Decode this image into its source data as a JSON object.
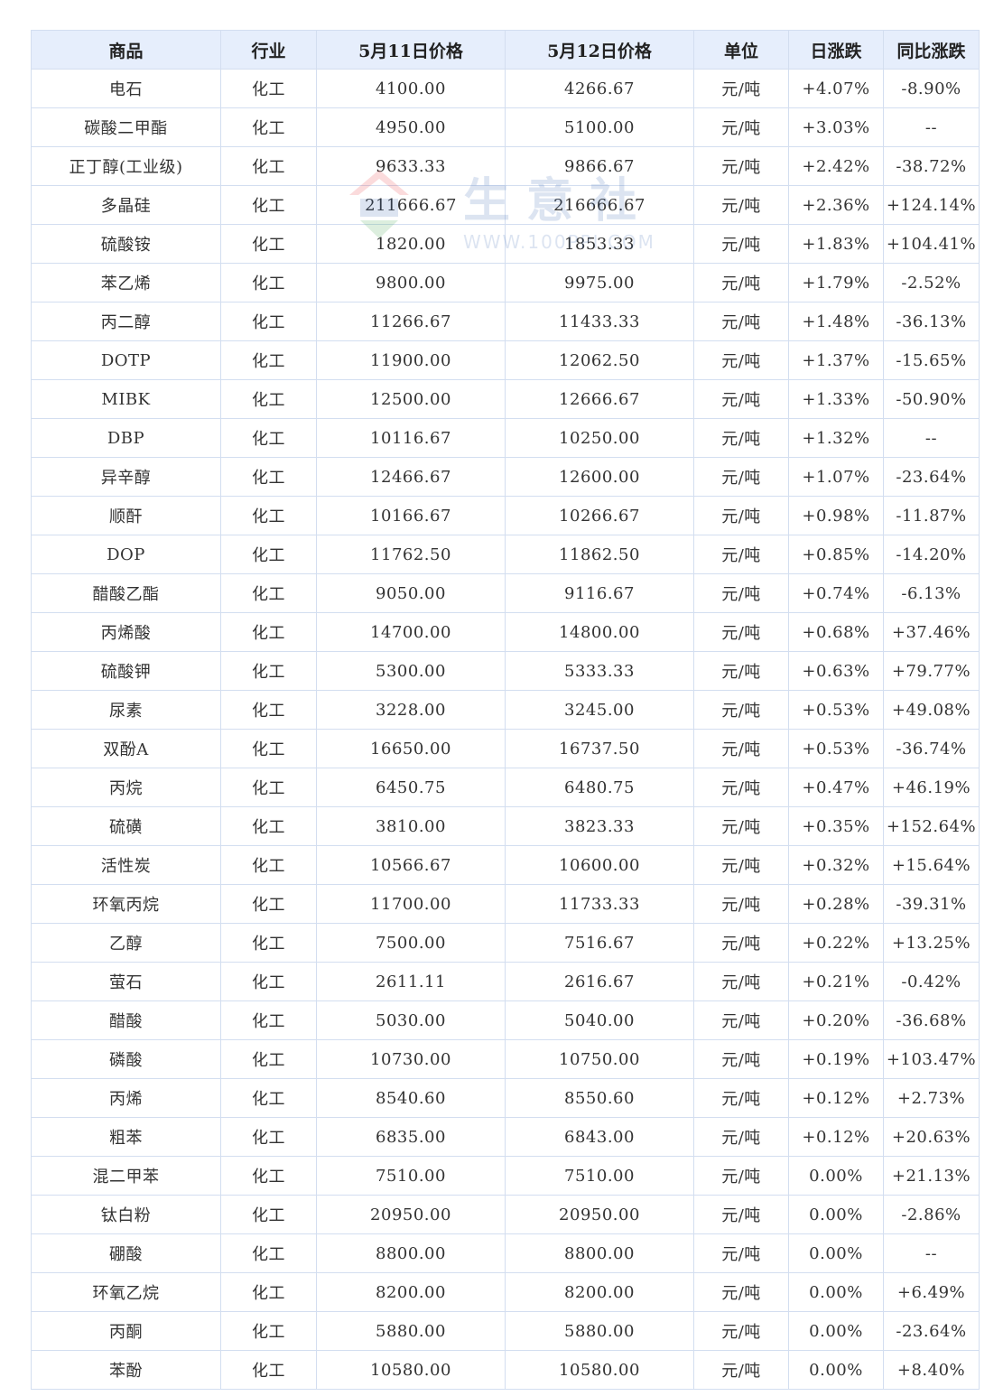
{
  "table": {
    "headers": {
      "name": "商品",
      "industry": "行业",
      "price_prev": "5月11日价格",
      "price_curr": "5月12日价格",
      "unit": "单位",
      "daily_change": "日涨跌",
      "yoy_change": "同比涨跌"
    },
    "rows": [
      {
        "name": "电石",
        "industry": "化工",
        "price_prev": "4100.00",
        "price_curr": "4266.67",
        "unit": "元/吨",
        "daily_change": "+4.07%",
        "daily_dir": "up",
        "yoy_change": "-8.90%",
        "yoy_dir": "down"
      },
      {
        "name": "碳酸二甲酯",
        "industry": "化工",
        "price_prev": "4950.00",
        "price_curr": "5100.00",
        "unit": "元/吨",
        "daily_change": "+3.03%",
        "daily_dir": "up",
        "yoy_change": "--",
        "yoy_dir": "flat"
      },
      {
        "name": "正丁醇(工业级)",
        "industry": "化工",
        "price_prev": "9633.33",
        "price_curr": "9866.67",
        "unit": "元/吨",
        "daily_change": "+2.42%",
        "daily_dir": "up",
        "yoy_change": "-38.72%",
        "yoy_dir": "down"
      },
      {
        "name": "多晶硅",
        "industry": "化工",
        "price_prev": "211666.67",
        "price_curr": "216666.67",
        "unit": "元/吨",
        "daily_change": "+2.36%",
        "daily_dir": "up",
        "yoy_change": "+124.14%",
        "yoy_dir": "up"
      },
      {
        "name": "硫酸铵",
        "industry": "化工",
        "price_prev": "1820.00",
        "price_curr": "1853.33",
        "unit": "元/吨",
        "daily_change": "+1.83%",
        "daily_dir": "up",
        "yoy_change": "+104.41%",
        "yoy_dir": "up"
      },
      {
        "name": "苯乙烯",
        "industry": "化工",
        "price_prev": "9800.00",
        "price_curr": "9975.00",
        "unit": "元/吨",
        "daily_change": "+1.79%",
        "daily_dir": "up",
        "yoy_change": "-2.52%",
        "yoy_dir": "down"
      },
      {
        "name": "丙二醇",
        "industry": "化工",
        "price_prev": "11266.67",
        "price_curr": "11433.33",
        "unit": "元/吨",
        "daily_change": "+1.48%",
        "daily_dir": "up",
        "yoy_change": "-36.13%",
        "yoy_dir": "down"
      },
      {
        "name": "DOTP",
        "industry": "化工",
        "price_prev": "11900.00",
        "price_curr": "12062.50",
        "unit": "元/吨",
        "daily_change": "+1.37%",
        "daily_dir": "up",
        "yoy_change": "-15.65%",
        "yoy_dir": "down"
      },
      {
        "name": "MIBK",
        "industry": "化工",
        "price_prev": "12500.00",
        "price_curr": "12666.67",
        "unit": "元/吨",
        "daily_change": "+1.33%",
        "daily_dir": "up",
        "yoy_change": "-50.90%",
        "yoy_dir": "down"
      },
      {
        "name": "DBP",
        "industry": "化工",
        "price_prev": "10116.67",
        "price_curr": "10250.00",
        "unit": "元/吨",
        "daily_change": "+1.32%",
        "daily_dir": "up",
        "yoy_change": "--",
        "yoy_dir": "flat"
      },
      {
        "name": "异辛醇",
        "industry": "化工",
        "price_prev": "12466.67",
        "price_curr": "12600.00",
        "unit": "元/吨",
        "daily_change": "+1.07%",
        "daily_dir": "up",
        "yoy_change": "-23.64%",
        "yoy_dir": "down"
      },
      {
        "name": "顺酐",
        "industry": "化工",
        "price_prev": "10166.67",
        "price_curr": "10266.67",
        "unit": "元/吨",
        "daily_change": "+0.98%",
        "daily_dir": "up",
        "yoy_change": "-11.87%",
        "yoy_dir": "down"
      },
      {
        "name": "DOP",
        "industry": "化工",
        "price_prev": "11762.50",
        "price_curr": "11862.50",
        "unit": "元/吨",
        "daily_change": "+0.85%",
        "daily_dir": "up",
        "yoy_change": "-14.20%",
        "yoy_dir": "down"
      },
      {
        "name": "醋酸乙酯",
        "industry": "化工",
        "price_prev": "9050.00",
        "price_curr": "9116.67",
        "unit": "元/吨",
        "daily_change": "+0.74%",
        "daily_dir": "up",
        "yoy_change": "-6.13%",
        "yoy_dir": "down"
      },
      {
        "name": "丙烯酸",
        "industry": "化工",
        "price_prev": "14700.00",
        "price_curr": "14800.00",
        "unit": "元/吨",
        "daily_change": "+0.68%",
        "daily_dir": "up",
        "yoy_change": "+37.46%",
        "yoy_dir": "up"
      },
      {
        "name": "硫酸钾",
        "industry": "化工",
        "price_prev": "5300.00",
        "price_curr": "5333.33",
        "unit": "元/吨",
        "daily_change": "+0.63%",
        "daily_dir": "up",
        "yoy_change": "+79.77%",
        "yoy_dir": "up"
      },
      {
        "name": "尿素",
        "industry": "化工",
        "price_prev": "3228.00",
        "price_curr": "3245.00",
        "unit": "元/吨",
        "daily_change": "+0.53%",
        "daily_dir": "up",
        "yoy_change": "+49.08%",
        "yoy_dir": "up"
      },
      {
        "name": "双酚A",
        "industry": "化工",
        "price_prev": "16650.00",
        "price_curr": "16737.50",
        "unit": "元/吨",
        "daily_change": "+0.53%",
        "daily_dir": "up",
        "yoy_change": "-36.74%",
        "yoy_dir": "down"
      },
      {
        "name": "丙烷",
        "industry": "化工",
        "price_prev": "6450.75",
        "price_curr": "6480.75",
        "unit": "元/吨",
        "daily_change": "+0.47%",
        "daily_dir": "up",
        "yoy_change": "+46.19%",
        "yoy_dir": "up"
      },
      {
        "name": "硫磺",
        "industry": "化工",
        "price_prev": "3810.00",
        "price_curr": "3823.33",
        "unit": "元/吨",
        "daily_change": "+0.35%",
        "daily_dir": "up",
        "yoy_change": "+152.64%",
        "yoy_dir": "up"
      },
      {
        "name": "活性炭",
        "industry": "化工",
        "price_prev": "10566.67",
        "price_curr": "10600.00",
        "unit": "元/吨",
        "daily_change": "+0.32%",
        "daily_dir": "up",
        "yoy_change": "+15.64%",
        "yoy_dir": "up"
      },
      {
        "name": "环氧丙烷",
        "industry": "化工",
        "price_prev": "11700.00",
        "price_curr": "11733.33",
        "unit": "元/吨",
        "daily_change": "+0.28%",
        "daily_dir": "up",
        "yoy_change": "-39.31%",
        "yoy_dir": "down"
      },
      {
        "name": "乙醇",
        "industry": "化工",
        "price_prev": "7500.00",
        "price_curr": "7516.67",
        "unit": "元/吨",
        "daily_change": "+0.22%",
        "daily_dir": "up",
        "yoy_change": "+13.25%",
        "yoy_dir": "up"
      },
      {
        "name": "萤石",
        "industry": "化工",
        "price_prev": "2611.11",
        "price_curr": "2616.67",
        "unit": "元/吨",
        "daily_change": "+0.21%",
        "daily_dir": "up",
        "yoy_change": "-0.42%",
        "yoy_dir": "down"
      },
      {
        "name": "醋酸",
        "industry": "化工",
        "price_prev": "5030.00",
        "price_curr": "5040.00",
        "unit": "元/吨",
        "daily_change": "+0.20%",
        "daily_dir": "up",
        "yoy_change": "-36.68%",
        "yoy_dir": "down"
      },
      {
        "name": "磷酸",
        "industry": "化工",
        "price_prev": "10730.00",
        "price_curr": "10750.00",
        "unit": "元/吨",
        "daily_change": "+0.19%",
        "daily_dir": "up",
        "yoy_change": "+103.47%",
        "yoy_dir": "up"
      },
      {
        "name": "丙烯",
        "industry": "化工",
        "price_prev": "8540.60",
        "price_curr": "8550.60",
        "unit": "元/吨",
        "daily_change": "+0.12%",
        "daily_dir": "up",
        "yoy_change": "+2.73%",
        "yoy_dir": "up"
      },
      {
        "name": "粗苯",
        "industry": "化工",
        "price_prev": "6835.00",
        "price_curr": "6843.00",
        "unit": "元/吨",
        "daily_change": "+0.12%",
        "daily_dir": "up",
        "yoy_change": "+20.63%",
        "yoy_dir": "up"
      },
      {
        "name": "混二甲苯",
        "industry": "化工",
        "price_prev": "7510.00",
        "price_curr": "7510.00",
        "unit": "元/吨",
        "daily_change": "0.00%",
        "daily_dir": "flat",
        "yoy_change": "+21.13%",
        "yoy_dir": "up"
      },
      {
        "name": "钛白粉",
        "industry": "化工",
        "price_prev": "20950.00",
        "price_curr": "20950.00",
        "unit": "元/吨",
        "daily_change": "0.00%",
        "daily_dir": "flat",
        "yoy_change": "-2.86%",
        "yoy_dir": "down"
      },
      {
        "name": "硼酸",
        "industry": "化工",
        "price_prev": "8800.00",
        "price_curr": "8800.00",
        "unit": "元/吨",
        "daily_change": "0.00%",
        "daily_dir": "flat",
        "yoy_change": "--",
        "yoy_dir": "flat"
      },
      {
        "name": "环氧乙烷",
        "industry": "化工",
        "price_prev": "8200.00",
        "price_curr": "8200.00",
        "unit": "元/吨",
        "daily_change": "0.00%",
        "daily_dir": "flat",
        "yoy_change": "+6.49%",
        "yoy_dir": "up"
      },
      {
        "name": "丙酮",
        "industry": "化工",
        "price_prev": "5880.00",
        "price_curr": "5880.00",
        "unit": "元/吨",
        "daily_change": "0.00%",
        "daily_dir": "flat",
        "yoy_change": "-23.64%",
        "yoy_dir": "down"
      },
      {
        "name": "苯酚",
        "industry": "化工",
        "price_prev": "10580.00",
        "price_curr": "10580.00",
        "unit": "元/吨",
        "daily_change": "0.00%",
        "daily_dir": "flat",
        "yoy_change": "+8.40%",
        "yoy_dir": "up"
      }
    ]
  },
  "watermark": {
    "brand": "生意社",
    "url": "WWW.100PPI.COM"
  },
  "colors": {
    "up": "#e8272f",
    "down": "#2a9d3a",
    "header_bg": "#e6eefc",
    "border": "#d3def0",
    "name_link": "#3a55a4"
  }
}
